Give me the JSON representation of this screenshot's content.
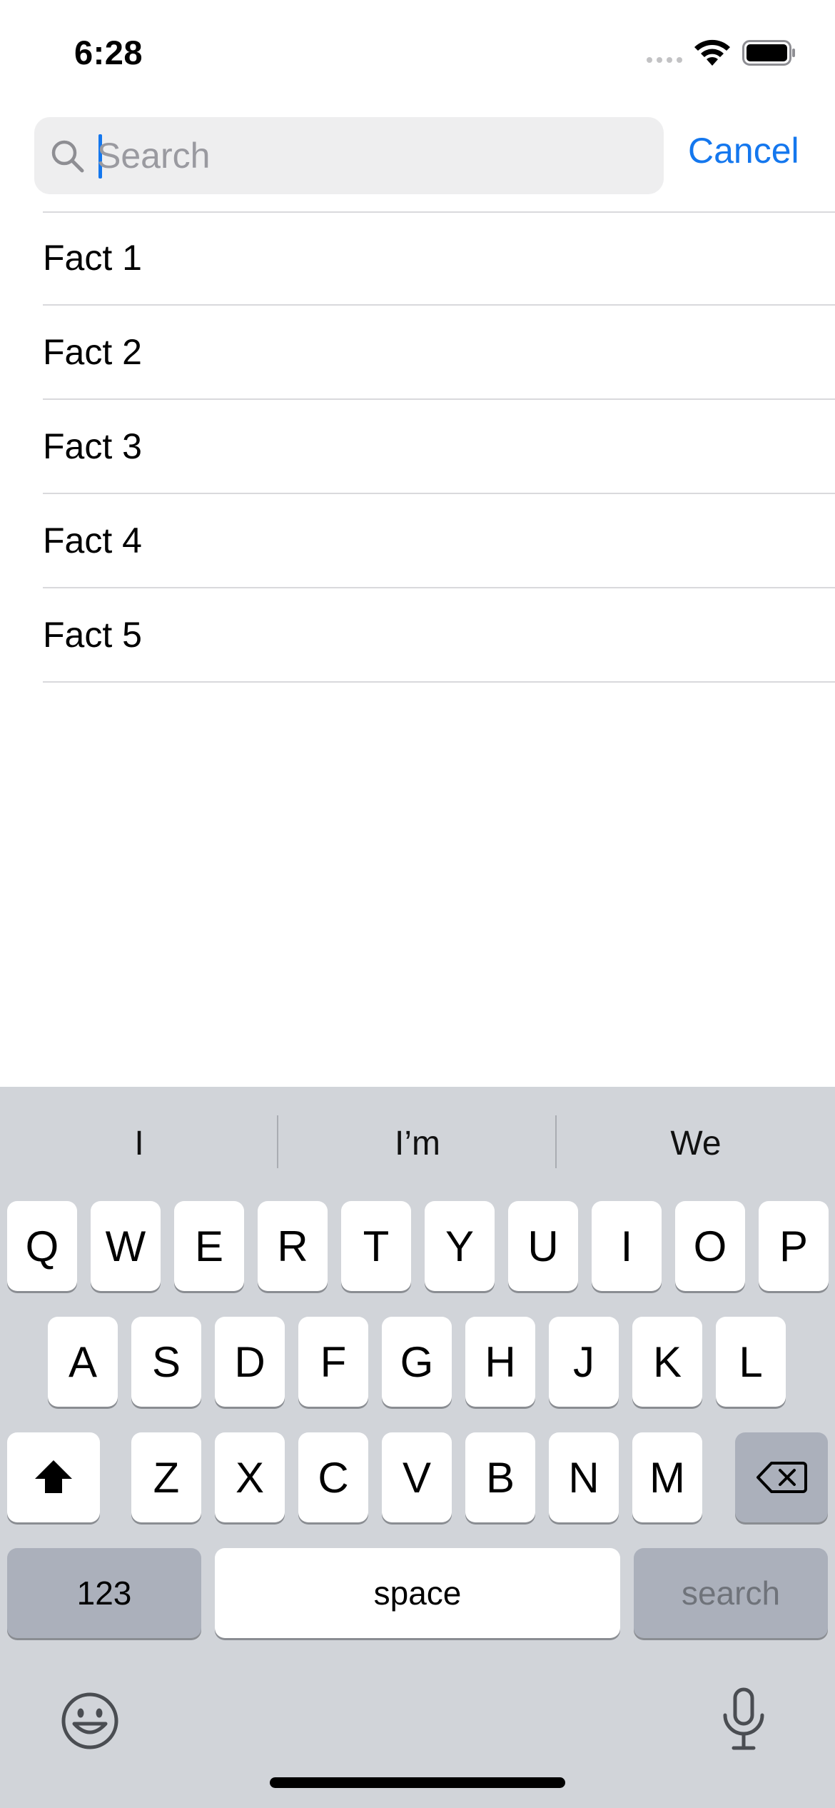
{
  "status_bar": {
    "time": "6:28",
    "icons": [
      "signal-dots-icon",
      "wifi-icon",
      "battery-icon"
    ]
  },
  "search": {
    "placeholder": "Search",
    "value": "",
    "icon": "magnifying-glass-icon",
    "cancel_label": "Cancel"
  },
  "list": {
    "items": [
      {
        "label": "Fact 1"
      },
      {
        "label": "Fact 2"
      },
      {
        "label": "Fact 3"
      },
      {
        "label": "Fact 4"
      },
      {
        "label": "Fact 5"
      }
    ]
  },
  "keyboard": {
    "suggestions": [
      "I",
      "I’m",
      "We"
    ],
    "row1": [
      "Q",
      "W",
      "E",
      "R",
      "T",
      "Y",
      "U",
      "I",
      "O",
      "P"
    ],
    "row2": [
      "A",
      "S",
      "D",
      "F",
      "G",
      "H",
      "J",
      "K",
      "L"
    ],
    "row3": [
      "Z",
      "X",
      "C",
      "V",
      "B",
      "N",
      "M"
    ],
    "numbers_label": "123",
    "space_label": "space",
    "search_label": "search",
    "icons": [
      "shift-icon",
      "delete-icon",
      "emoji-icon",
      "microphone-icon"
    ]
  },
  "colors": {
    "accent": "#1477ee",
    "keyboard_bg": "#d1d4d9",
    "search_field_bg": "#eeeeef"
  }
}
